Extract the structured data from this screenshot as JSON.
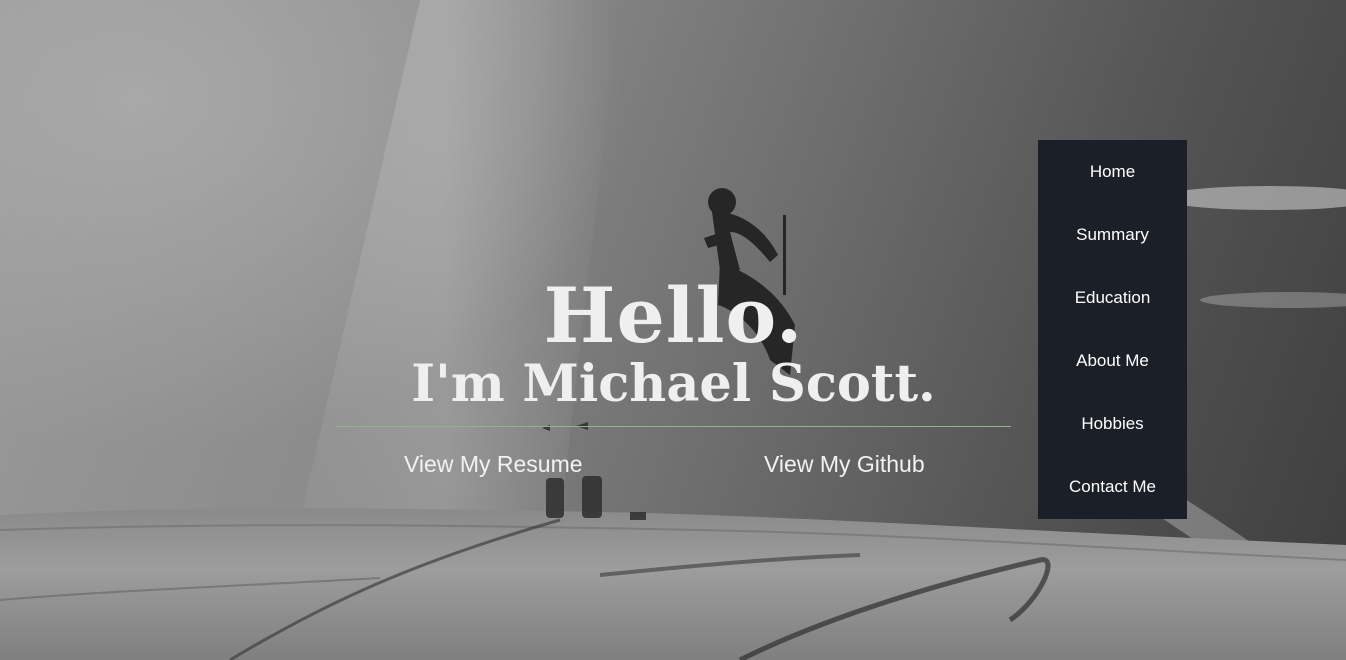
{
  "hero": {
    "greeting": "Hello.",
    "intro": "I'm Michael Scott.",
    "divider_color": "#8fb58a",
    "links": {
      "resume": "View My Resume",
      "github": "View My Github"
    }
  },
  "nav": {
    "background": "#1b1f27",
    "items": [
      {
        "label": "Home"
      },
      {
        "label": "Summary"
      },
      {
        "label": "Education"
      },
      {
        "label": "About Me"
      },
      {
        "label": "Hobbies"
      },
      {
        "label": "Contact Me"
      }
    ]
  },
  "background_image": {
    "subject": "dirt-bike-rider-jumping-over-sand-dunes",
    "style": "grayscale"
  }
}
